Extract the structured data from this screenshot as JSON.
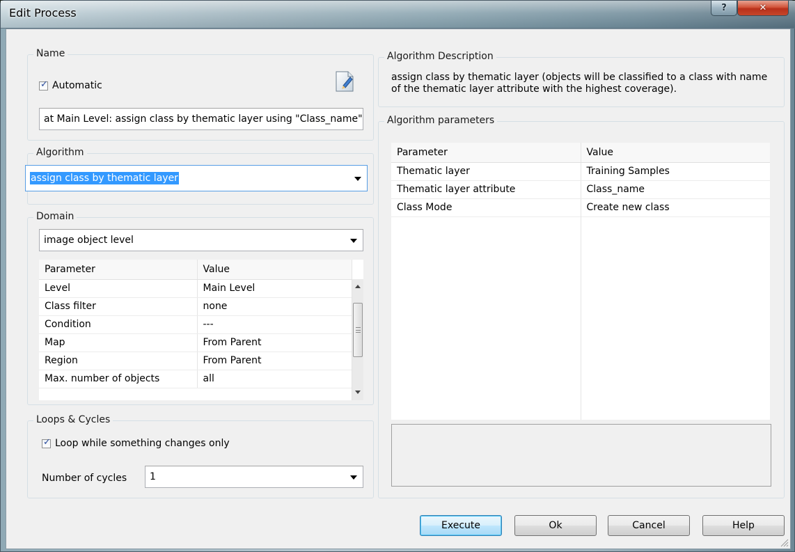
{
  "window": {
    "title": "Edit Process",
    "help_glyph": "?",
    "close_glyph": "✕"
  },
  "name_group": {
    "label": "Name",
    "automatic_label": "Automatic",
    "automatic_checked": true,
    "name_value": "at  Main Level: assign class by thematic layer using \"Class_name\" values"
  },
  "algorithm_group": {
    "label": "Algorithm",
    "selected": "assign class by thematic layer"
  },
  "domain_group": {
    "label": "Domain",
    "selected": "image object level",
    "columns": [
      "Parameter",
      "Value"
    ],
    "rows": [
      {
        "parameter": "Level",
        "value": "Main Level"
      },
      {
        "parameter": "Class filter",
        "value": "none"
      },
      {
        "parameter": "Condition",
        "value": "---"
      },
      {
        "parameter": "Map",
        "value": "From Parent"
      },
      {
        "parameter": "Region",
        "value": "From Parent"
      },
      {
        "parameter": "Max. number of objects",
        "value": "all"
      }
    ]
  },
  "loops_group": {
    "label": "Loops & Cycles",
    "loop_label": "Loop while something changes only",
    "loop_checked": true,
    "cycles_label": "Number of cycles",
    "cycles_value": "1"
  },
  "description_group": {
    "label": "Algorithm Description",
    "text": "assign class by thematic layer (objects will be classified to a class with name of the thematic layer attribute with the highest coverage)."
  },
  "parameters_group": {
    "label": "Algorithm parameters",
    "columns": [
      "Parameter",
      "Value"
    ],
    "rows": [
      {
        "parameter": "Thematic layer",
        "value": "Training Samples"
      },
      {
        "parameter": "Thematic layer attribute",
        "value": "Class_name"
      },
      {
        "parameter": "Class Mode",
        "value": "Create new class"
      }
    ]
  },
  "buttons": {
    "execute": "Execute",
    "ok": "Ok",
    "cancel": "Cancel",
    "help": "Help"
  },
  "colors": {
    "selection": "#3399ff",
    "default_button_border": "#3c7fb1",
    "close_button": "#c6462b"
  }
}
